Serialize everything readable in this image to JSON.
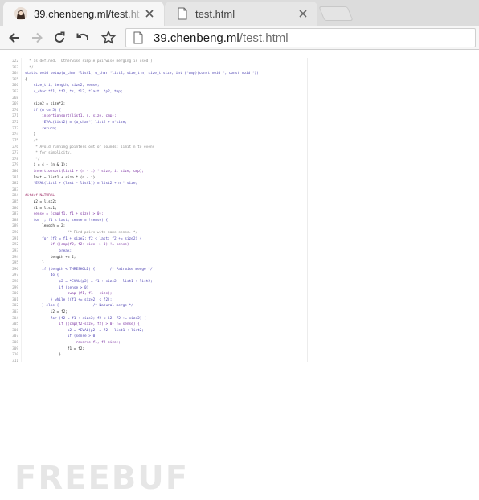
{
  "tabs": [
    {
      "title": "39.chenbeng.ml/test.ht",
      "icon": "avatar-favicon",
      "active": true
    },
    {
      "title": "test.html",
      "icon": "page-icon",
      "active": false
    }
  ],
  "toolbar": {
    "url_host": "39.chenbeng.ml",
    "url_path": "/test.html",
    "buttons": [
      "back-icon",
      "forward-icon",
      "reload-icon",
      "undo-icon",
      "star-icon"
    ]
  },
  "code": {
    "lines": [
      {
        "n": "222",
        "t": "  * is defined.  Otherwise simple pairwise merging is used.)",
        "c": "cm"
      },
      {
        "n": "263",
        "t": "  */",
        "c": "cm"
      },
      {
        "n": "264",
        "t": "static void setup(u_char *list1, u_char *list2, size_t n, size_t size, int (*cmp)(const void *, const void *))",
        "c": "kw"
      },
      {
        "n": "265",
        "t": "{",
        "c": ""
      },
      {
        "n": "266",
        "t": "    size_t i, length, size2, sense;",
        "c": "kw"
      },
      {
        "n": "267",
        "t": "    u_char *f1, *f2, *s, *l2, *last, *p2, tmp;",
        "c": "kw"
      },
      {
        "n": "268",
        "t": "",
        "c": ""
      },
      {
        "n": "269",
        "t": "    size2 = size*2;",
        "c": ""
      },
      {
        "n": "270",
        "t": "    if (n <= 5) {",
        "c": "kw"
      },
      {
        "n": "271",
        "t": "        insertionsort(list1, n, size, cmp);",
        "c": "fn"
      },
      {
        "n": "272",
        "t": "        *EVAL(list2) = (u_char*) list2 + n*size;",
        "c": "kw"
      },
      {
        "n": "273",
        "t": "        return;",
        "c": "kw"
      },
      {
        "n": "274",
        "t": "    }",
        "c": ""
      },
      {
        "n": "275",
        "t": "    /*",
        "c": "cm"
      },
      {
        "n": "276",
        "t": "     * Avoid running pointers out of bounds; limit n to evens",
        "c": "cm"
      },
      {
        "n": "277",
        "t": "     * for simplicity.",
        "c": "cm"
      },
      {
        "n": "278",
        "t": "     */",
        "c": "cm"
      },
      {
        "n": "279",
        "t": "    i = 4 + (n & 1);",
        "c": ""
      },
      {
        "n": "280",
        "t": "    insertionsort(list1 + (n - i) * size, i, size, cmp);",
        "c": "fn"
      },
      {
        "n": "281",
        "t": "    last = list1 + size * (n - i);",
        "c": ""
      },
      {
        "n": "282",
        "t": "    *EVAL(list2 + (last - list1)) = list2 + n * size;",
        "c": "kw"
      },
      {
        "n": "283",
        "t": "",
        "c": ""
      },
      {
        "n": "284",
        "t": "#ifdef NATURAL",
        "c": "pp"
      },
      {
        "n": "285",
        "t": "    p2 = list2;",
        "c": ""
      },
      {
        "n": "286",
        "t": "    f1 = list1;",
        "c": ""
      },
      {
        "n": "287",
        "t": "    sense = (cmp(f1, f1 + size) > 0);",
        "c": "fn"
      },
      {
        "n": "288",
        "t": "    for (; f1 < last; sense = !sense) {",
        "c": "kw"
      },
      {
        "n": "289",
        "t": "        length = 2;",
        "c": ""
      },
      {
        "n": "290",
        "t": "                    /* Find pairs with same sense. */",
        "c": "cm"
      },
      {
        "n": "291",
        "t": "        for (f2 = f1 + size2; f2 < last; f2 += size2) {",
        "c": "kw"
      },
      {
        "n": "292",
        "t": "            if ((cmp(f2, f2+ size) > 0) != sense)",
        "c": "fn"
      },
      {
        "n": "293",
        "t": "                break;",
        "c": "kw"
      },
      {
        "n": "294",
        "t": "            length += 2;",
        "c": ""
      },
      {
        "n": "295",
        "t": "        }",
        "c": ""
      },
      {
        "n": "296",
        "t": "        if (length < THRESHOLD) {       /* Pairwise merge */",
        "c": "kw"
      },
      {
        "n": "297",
        "t": "            do {",
        "c": "kw"
      },
      {
        "n": "298",
        "t": "                p2 = *EVAL(p2) = f1 + size2 - list1 + list2;",
        "c": "kw"
      },
      {
        "n": "299",
        "t": "                if (sense > 0)",
        "c": "kw"
      },
      {
        "n": "300",
        "t": "                    swap (f1, f1 + size);",
        "c": "fn"
      },
      {
        "n": "301",
        "t": "            } while ((f1 += size2) < f2);",
        "c": "kw"
      },
      {
        "n": "302",
        "t": "        } else {                /* Natural merge */",
        "c": "kw"
      },
      {
        "n": "303",
        "t": "            l2 = f2;",
        "c": ""
      },
      {
        "n": "304",
        "t": "            for (f2 = f1 + size2; f2 < l2; f2 += size2) {",
        "c": "kw"
      },
      {
        "n": "305",
        "t": "                if ((cmp(f2-size, f2) > 0) != sense) {",
        "c": "fn"
      },
      {
        "n": "306",
        "t": "                    p2 = *EVAL(p2) = f2 - list1 + list2;",
        "c": "kw"
      },
      {
        "n": "307",
        "t": "                    if (sense > 0)",
        "c": "kw"
      },
      {
        "n": "308",
        "t": "                        reverse(f1, f2-size);",
        "c": "fn"
      },
      {
        "n": "309",
        "t": "                    f1 = f2;",
        "c": ""
      },
      {
        "n": "310",
        "t": "                }",
        "c": ""
      },
      {
        "n": "311",
        "t": "",
        "c": ""
      }
    ]
  },
  "watermark": {
    "text": "FREEBUF"
  },
  "colors": {
    "keyword": "#4a3fb0",
    "function": "#7a2fa0",
    "comment": "#8a8a8a",
    "preprocessor": "#a0306a",
    "text": "#222222"
  }
}
